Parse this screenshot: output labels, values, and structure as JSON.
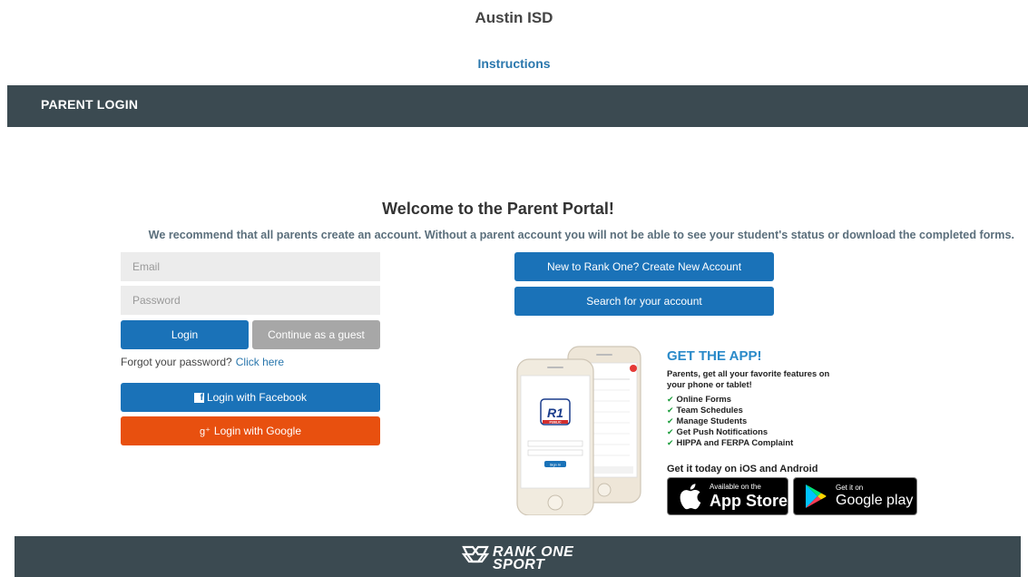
{
  "header": {
    "district_name": "Austin ISD",
    "instructions_label": "Instructions"
  },
  "top_bar": {
    "title": "PARENT LOGIN"
  },
  "main": {
    "welcome": "Welcome to the Parent Portal!",
    "recommendation": "We recommend that all parents create an account. Without a parent account you will not be able to see your student's status or download the completed forms."
  },
  "login_form": {
    "email_placeholder": "Email",
    "password_placeholder": "Password",
    "login_label": "Login",
    "guest_label": "Continue as a guest",
    "forgot_text": "Forgot your password?",
    "forgot_link": "Click here",
    "facebook_label": "Login with Facebook",
    "google_label": "Login with Google"
  },
  "account_actions": {
    "create_label": "New to Rank One? Create New Account",
    "search_label": "Search for your account"
  },
  "app_promo": {
    "title": "GET THE APP!",
    "description": "Parents, get all your favorite features on your phone or tablet!",
    "features": [
      "Online Forms",
      "Team Schedules",
      "Manage Students",
      "Get Push Notifications",
      "HIPPA and FERPA Complaint"
    ],
    "get_it": "Get it today on iOS and Android",
    "phone_logo": "R1",
    "phone_logo_sub": "PUBLIC",
    "phone_signin": "Sign In",
    "app_store": {
      "small": "Available on the",
      "big": "App Store"
    },
    "google_play": {
      "small": "Get it on",
      "big": "Google play"
    }
  },
  "footer": {
    "logo_line1": "RANK ONE",
    "logo_line2": "SPORT"
  },
  "colors": {
    "bar": "#3b4a51",
    "primary": "#1a72b8",
    "google": "#e8500f",
    "guest": "#a7a7a7",
    "link": "#2a77ad",
    "accent": "#2a8ac9"
  }
}
